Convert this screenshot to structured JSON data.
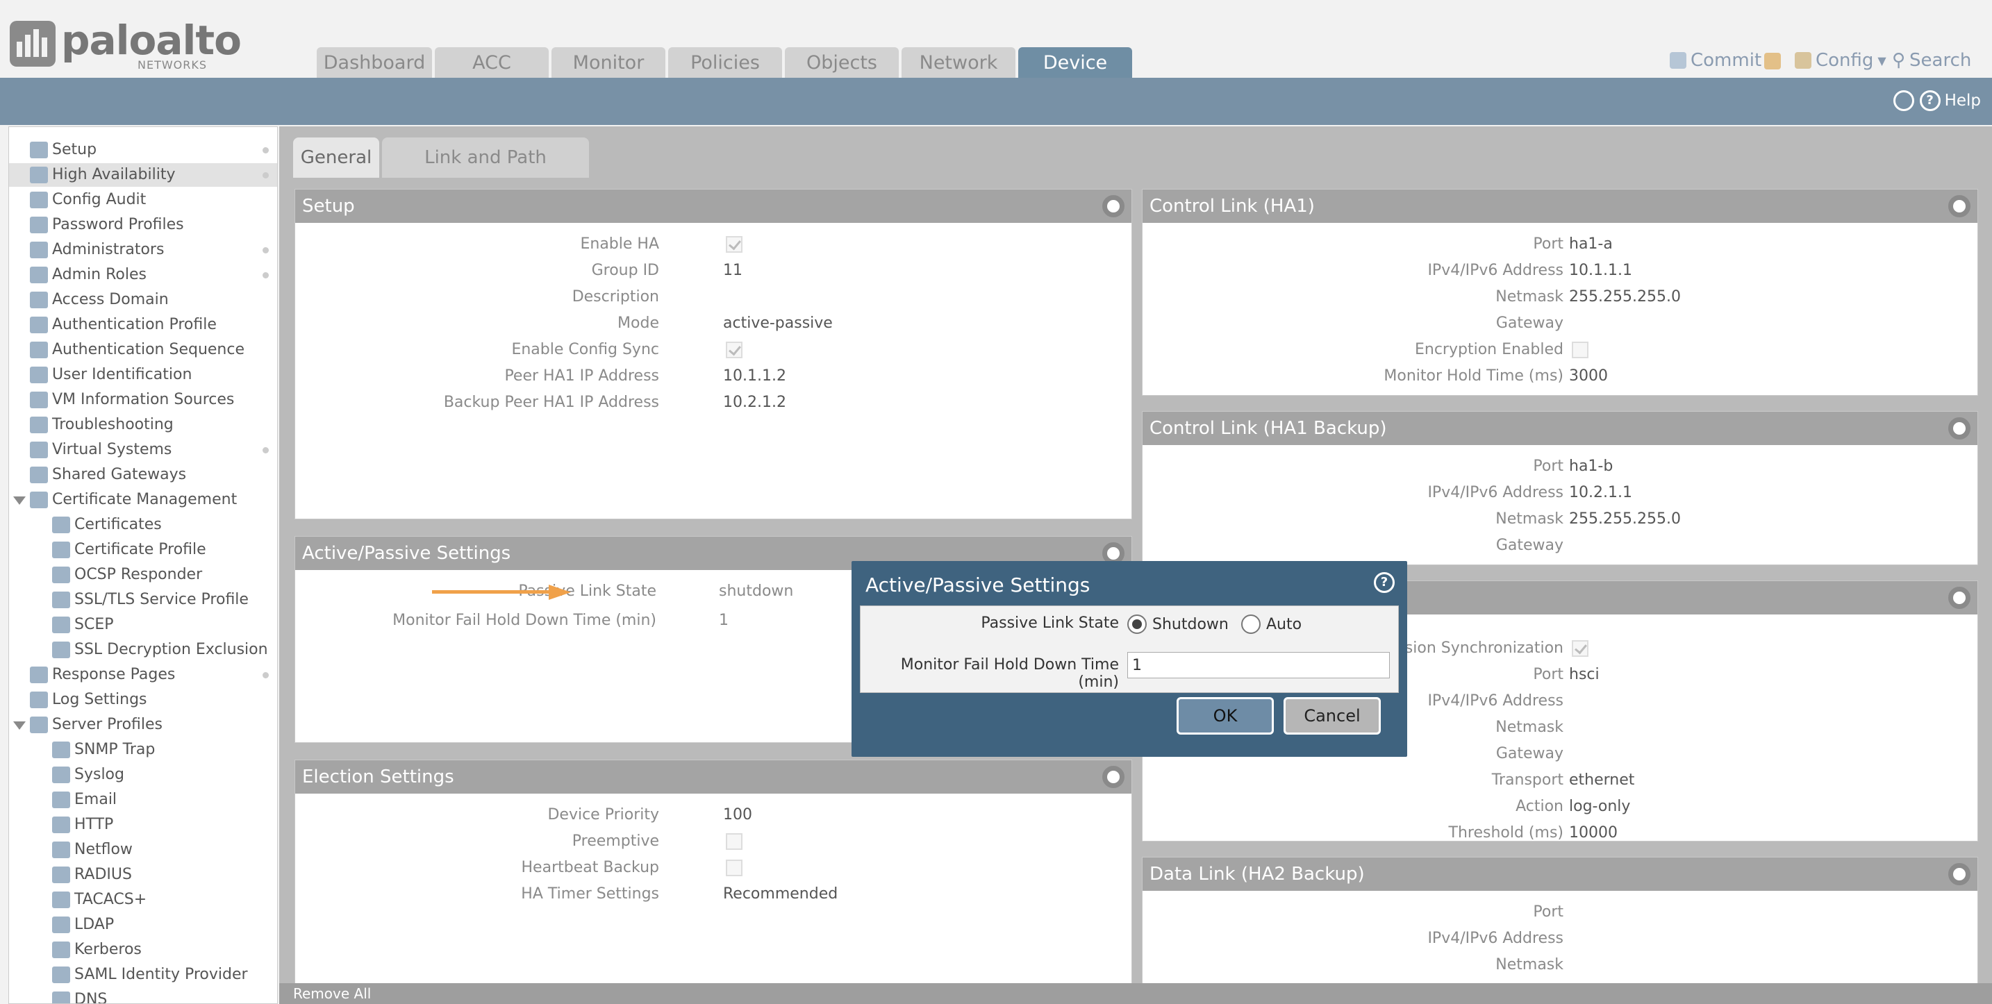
{
  "brand": {
    "name": "paloalto",
    "sub": "NETWORKS"
  },
  "tabs": [
    {
      "label": "Dashboard",
      "active": false
    },
    {
      "label": "ACC",
      "active": false
    },
    {
      "label": "Monitor",
      "active": false
    },
    {
      "label": "Policies",
      "active": false
    },
    {
      "label": "Objects",
      "active": false
    },
    {
      "label": "Network",
      "active": false
    },
    {
      "label": "Device",
      "active": true
    }
  ],
  "header_tools": {
    "commit": "Commit",
    "config": "Config",
    "search": "Search"
  },
  "help_label": "Help",
  "sidebar": [
    {
      "label": "Setup",
      "level": 0
    },
    {
      "label": "High Availability",
      "level": 0,
      "selected": true
    },
    {
      "label": "Config Audit",
      "level": 0
    },
    {
      "label": "Password Profiles",
      "level": 0
    },
    {
      "label": "Administrators",
      "level": 0
    },
    {
      "label": "Admin Roles",
      "level": 0
    },
    {
      "label": "Access Domain",
      "level": 0
    },
    {
      "label": "Authentication Profile",
      "level": 0
    },
    {
      "label": "Authentication Sequence",
      "level": 0
    },
    {
      "label": "User Identification",
      "level": 0
    },
    {
      "label": "VM Information Sources",
      "level": 0
    },
    {
      "label": "Troubleshooting",
      "level": 0
    },
    {
      "label": "Virtual Systems",
      "level": 0
    },
    {
      "label": "Shared Gateways",
      "level": 0
    },
    {
      "label": "Certificate Management",
      "level": 0,
      "expanded": true
    },
    {
      "label": "Certificates",
      "level": 1
    },
    {
      "label": "Certificate Profile",
      "level": 1
    },
    {
      "label": "OCSP Responder",
      "level": 1
    },
    {
      "label": "SSL/TLS Service Profile",
      "level": 1
    },
    {
      "label": "SCEP",
      "level": 1
    },
    {
      "label": "SSL Decryption Exclusion",
      "level": 1
    },
    {
      "label": "Response Pages",
      "level": 0
    },
    {
      "label": "Log Settings",
      "level": 0
    },
    {
      "label": "Server Profiles",
      "level": 0,
      "expanded": true
    },
    {
      "label": "SNMP Trap",
      "level": 1
    },
    {
      "label": "Syslog",
      "level": 1
    },
    {
      "label": "Email",
      "level": 1
    },
    {
      "label": "HTTP",
      "level": 1
    },
    {
      "label": "Netflow",
      "level": 1
    },
    {
      "label": "RADIUS",
      "level": 1
    },
    {
      "label": "TACACS+",
      "level": 1
    },
    {
      "label": "LDAP",
      "level": 1
    },
    {
      "label": "Kerberos",
      "level": 1
    },
    {
      "label": "SAML Identity Provider",
      "level": 1
    },
    {
      "label": "DNS",
      "level": 1
    }
  ],
  "subtabs": [
    {
      "label": "General",
      "active": true
    },
    {
      "label": "Link and Path Monitoring",
      "active": false
    }
  ],
  "setup": {
    "title": "Setup",
    "enable_ha_label": "Enable HA",
    "group_id_label": "Group ID",
    "group_id": "11",
    "description_label": "Description",
    "mode_label": "Mode",
    "mode": "active-passive",
    "config_sync_label": "Enable Config Sync",
    "peer_label": "Peer HA1 IP Address",
    "peer": "10.1.1.2",
    "backup_peer_label": "Backup Peer HA1 IP Address",
    "backup_peer": "10.2.1.2"
  },
  "ap": {
    "title": "Active/Passive Settings",
    "pls_label": "Passive Link State",
    "pls": "shutdown",
    "mfhd_label": "Monitor Fail Hold Down Time (min)",
    "mfhd": "1"
  },
  "election": {
    "title": "Election Settings",
    "priority_label": "Device Priority",
    "priority": "100",
    "preemptive_label": "Preemptive",
    "heartbeat_label": "Heartbeat Backup",
    "timer_label": "HA Timer Settings",
    "timer": "Recommended"
  },
  "ha1": {
    "title": "Control Link (HA1)",
    "port_label": "Port",
    "port": "ha1-a",
    "ip_label": "IPv4/IPv6 Address",
    "ip": "10.1.1.1",
    "netmask_label": "Netmask",
    "netmask": "255.255.255.0",
    "gateway_label": "Gateway",
    "enc_label": "Encryption Enabled",
    "hold_label": "Monitor Hold Time (ms)",
    "hold": "3000"
  },
  "ha1b": {
    "title": "Control Link (HA1 Backup)",
    "port_label": "Port",
    "port": "ha1-b",
    "ip_label": "IPv4/IPv6 Address",
    "ip": "10.2.1.1",
    "netmask_label": "Netmask",
    "netmask": "255.255.255.0",
    "gateway_label": "Gateway"
  },
  "ha2": {
    "sync_label": "ession Synchronization",
    "port_label": "Port",
    "port": "hsci",
    "ip_label": "IPv4/IPv6 Address",
    "netmask_label": "Netmask",
    "gateway_label": "Gateway",
    "transport_label": "Transport",
    "transport": "ethernet",
    "action_label": "Action",
    "action": "log-only",
    "threshold_label": "Threshold (ms)",
    "threshold": "10000"
  },
  "ha2b": {
    "title": "Data Link (HA2 Backup)",
    "port_label": "Port",
    "ip_label": "IPv4/IPv6 Address",
    "netmask_label": "Netmask"
  },
  "modal": {
    "title": "Active/Passive Settings",
    "pls_label": "Passive Link State",
    "opt_shutdown": "Shutdown",
    "opt_auto": "Auto",
    "selected": "Shutdown",
    "mfhd_label": "Monitor Fail Hold Down Time (min)",
    "mfhd_value": "1",
    "ok": "OK",
    "cancel": "Cancel"
  },
  "bottom": {
    "remove_all": "Remove All"
  },
  "colors": {
    "accent": "#6f8ea4",
    "bar": "#7891a6",
    "modal": "#3f637f",
    "arrow": "#f0a14a"
  }
}
